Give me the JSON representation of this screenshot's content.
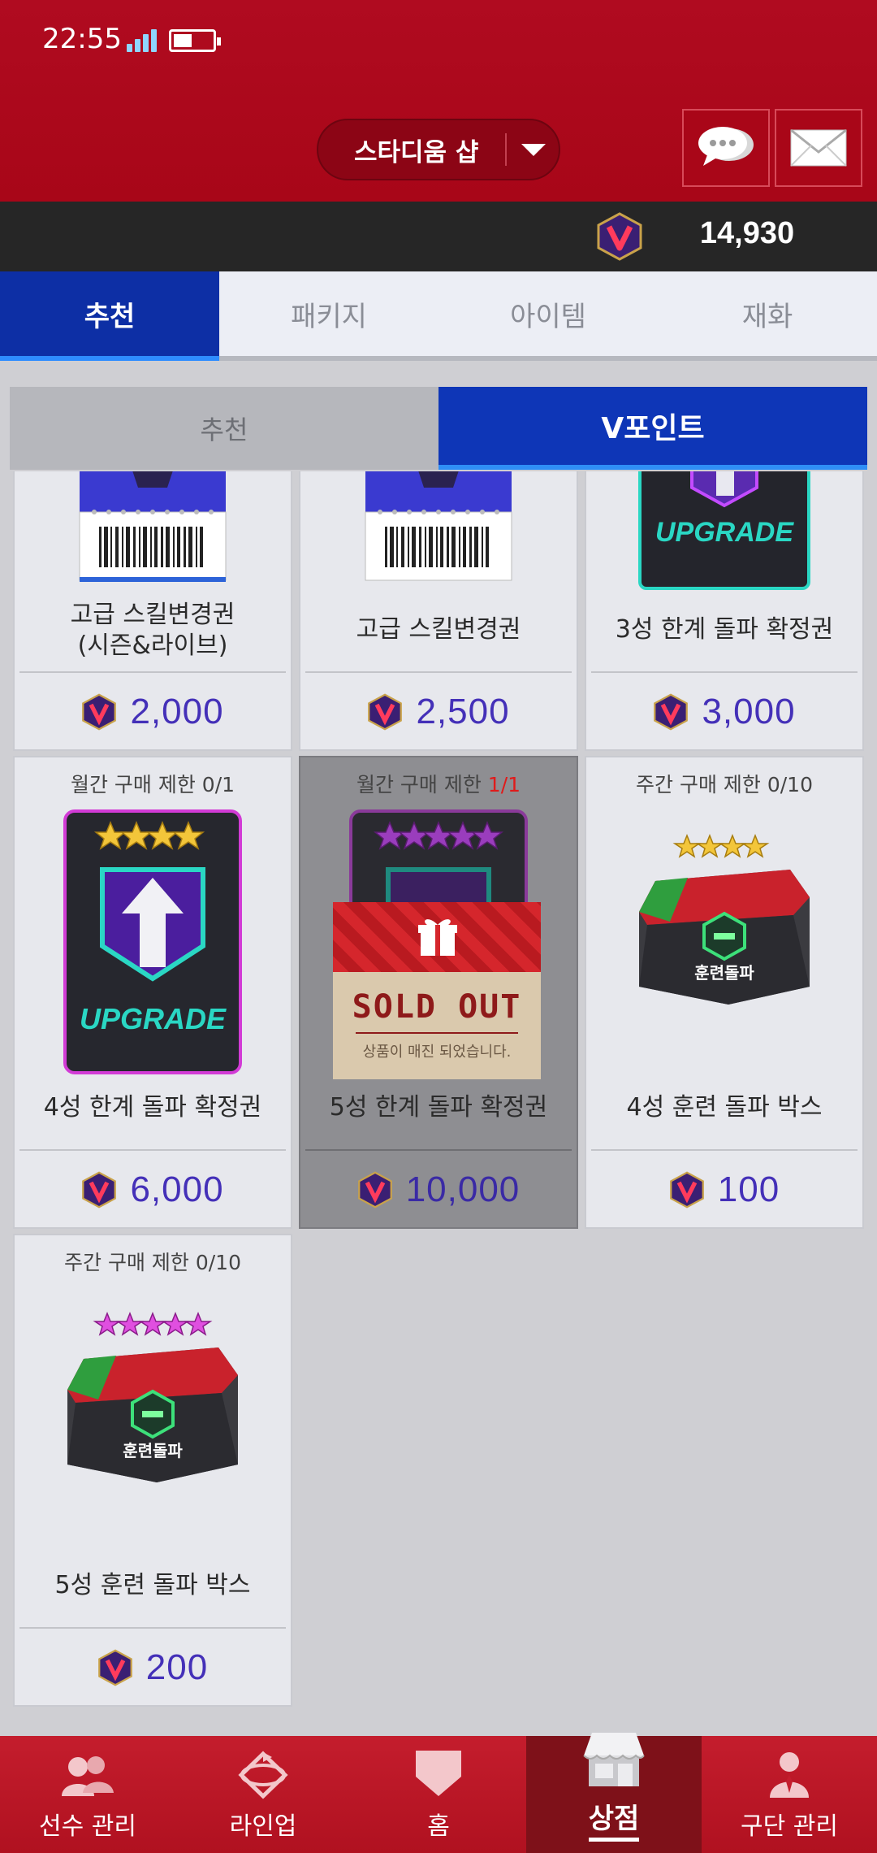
{
  "status_bar": {
    "time": "22:55"
  },
  "header": {
    "shop_title": "스타디움 샵",
    "chat_icon": "chat-bubble-icon",
    "mail_icon": "envelope-icon"
  },
  "currency": {
    "icon": "v-point-icon",
    "amount": "14,930"
  },
  "main_tabs": [
    {
      "label": "추천",
      "active": true
    },
    {
      "label": "패키지",
      "active": false
    },
    {
      "label": "아이템",
      "active": false
    },
    {
      "label": "재화",
      "active": false
    }
  ],
  "sub_tabs": [
    {
      "label": "추천",
      "active": false
    },
    {
      "label": "V포인트",
      "active": true
    }
  ],
  "products": [
    {
      "name_line1": "고급 스킬변경권",
      "name_line2": "(시즌&라이브)",
      "price": "2,000",
      "art": "skill-ticket"
    },
    {
      "name_line1": "고급 스킬변경권",
      "price": "2,500",
      "art": "skill-ticket"
    },
    {
      "name_line1": "3성 한계 돌파 확정권",
      "price": "3,000",
      "art": "upgrade-card",
      "art_text": "UPGRADE"
    },
    {
      "limit": "월간 구매 제한 0/1",
      "name_line1": "4성 한계 돌파 확정권",
      "price": "6,000",
      "art": "upgrade-card",
      "art_text": "UPGRADE",
      "stars": 4
    },
    {
      "limit_prefix": "월간 구매 제한 ",
      "limit_count": "1/1",
      "name_line1": "5성 한계 돌파 확정권",
      "price": "10,000",
      "art": "upgrade-card",
      "stars": 5,
      "sold_out": true,
      "sold_out_title": "SOLD OUT",
      "sold_out_sub": "상품이 매진 되었습니다."
    },
    {
      "limit": "주간 구매 제한 0/10",
      "name_line1": "4성 훈련 돌파 박스",
      "price": "100",
      "art": "training-box",
      "art_text": "훈련돌파",
      "stars": 4
    },
    {
      "limit": "주간 구매 제한 0/10",
      "name_line1": "5성 훈련 돌파 박스",
      "price": "200",
      "art": "training-box",
      "art_text": "훈련돌파",
      "stars": 5
    }
  ],
  "bottom_nav": [
    {
      "label": "선수 관리",
      "icon": "players-icon",
      "active": false
    },
    {
      "label": "라인업",
      "icon": "baseball-field-icon",
      "active": false
    },
    {
      "label": "홈",
      "icon": "home-plate-icon",
      "active": false
    },
    {
      "label": "상점",
      "icon": "store-icon",
      "active": true
    },
    {
      "label": "구단 관리",
      "icon": "manager-icon",
      "active": false
    }
  ]
}
